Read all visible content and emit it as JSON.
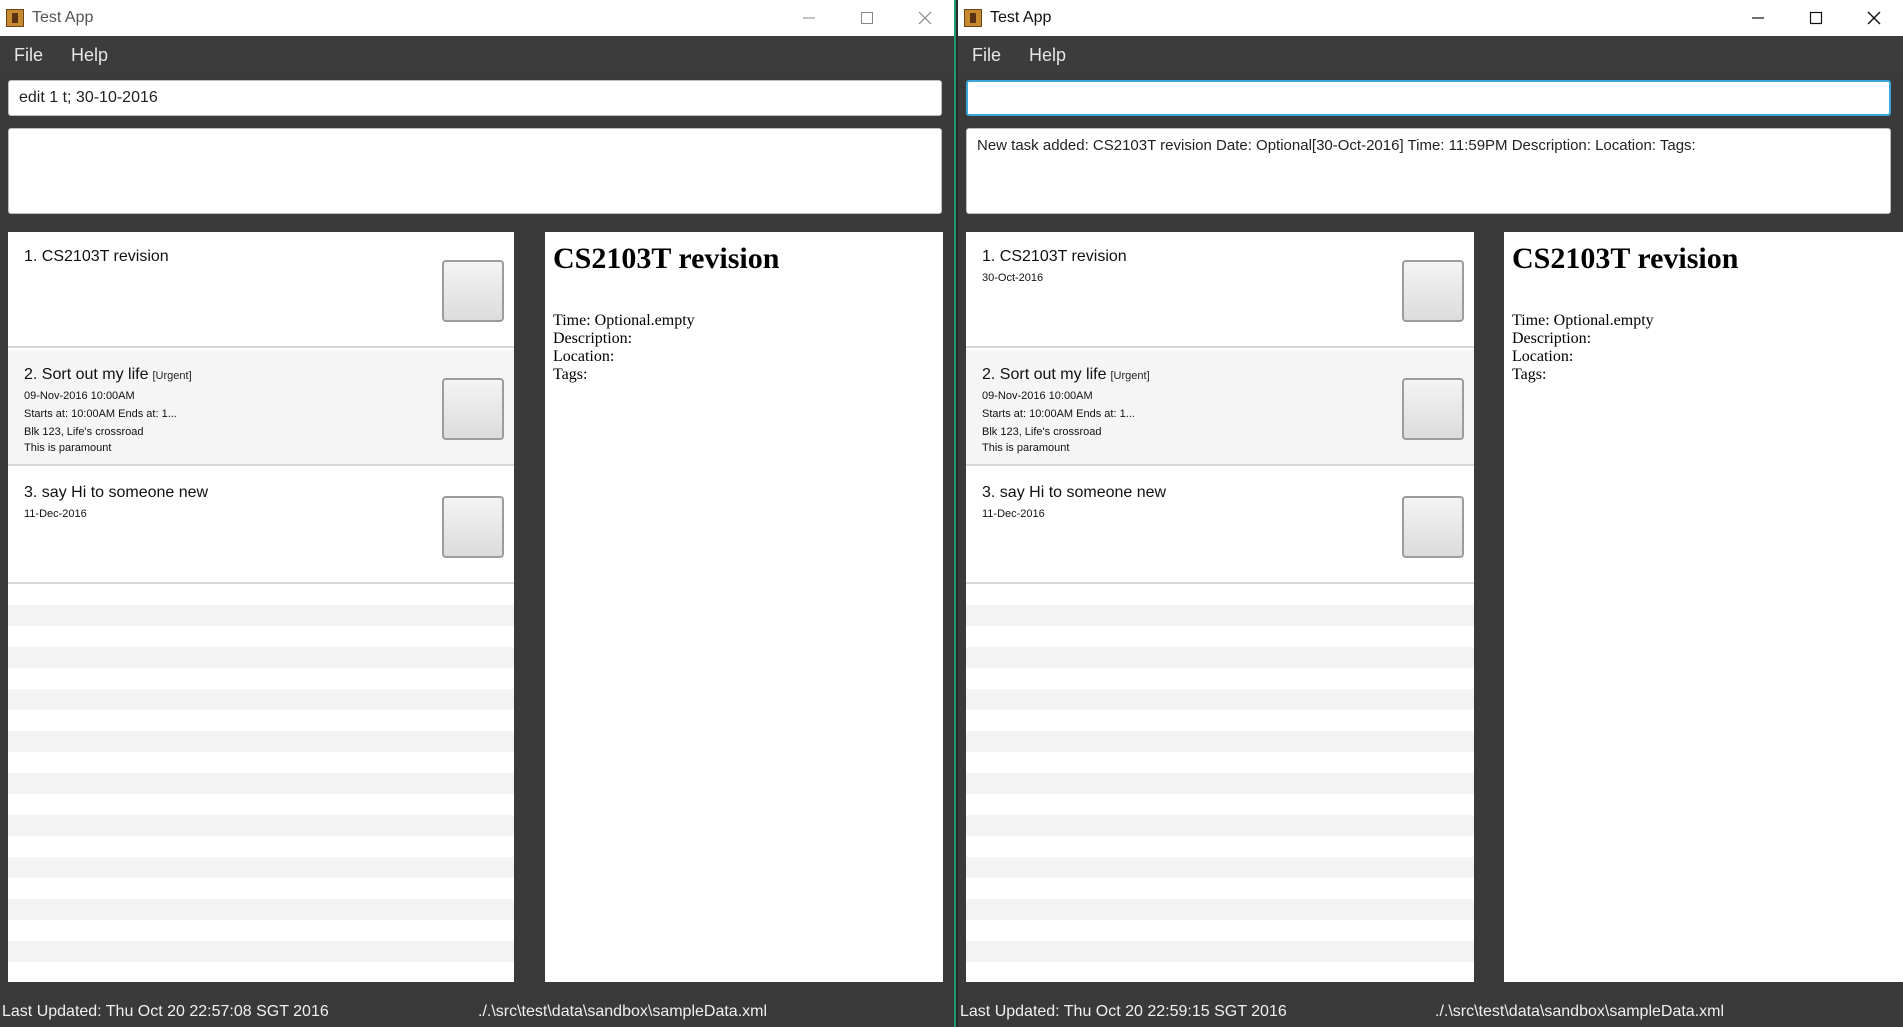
{
  "left_window": {
    "title": "Test App",
    "menu": [
      "File",
      "Help"
    ],
    "command_value": "edit 1 t; 30-10-2016",
    "result_text": "",
    "tasks": [
      {
        "title": "1. CS2103T revision",
        "tag": "",
        "lines": []
      },
      {
        "title": "2. Sort out my life",
        "tag": "[Urgent]",
        "lines": [
          "09-Nov-2016 10:00AM",
          "Starts at: 10:00AM   Ends at: 1...",
          "Blk 123, Life's crossroad",
          "This is paramount"
        ]
      },
      {
        "title": "3. say Hi to someone new",
        "tag": "",
        "lines": [
          "11-Dec-2016"
        ]
      }
    ],
    "detail": {
      "title": "CS2103T revision",
      "time": "Time: Optional.empty",
      "description": "Description:",
      "location": "Location:",
      "tags": "Tags:"
    },
    "status_left": "Last Updated: Thu Oct 20 22:57:08 SGT 2016",
    "status_right": "./.\\src\\test\\data\\sandbox\\sampleData.xml"
  },
  "right_window": {
    "title": "Test App",
    "menu": [
      "File",
      "Help"
    ],
    "command_value": "",
    "result_text": "New task added: CS2103T revision Date: Optional[30-Oct-2016] Time: 11:59PM Description:  Location:   Tags:",
    "tasks": [
      {
        "title": "1. CS2103T revision",
        "tag": "",
        "lines": [
          "30-Oct-2016"
        ]
      },
      {
        "title": "2. Sort out my life",
        "tag": "[Urgent]",
        "lines": [
          "09-Nov-2016 10:00AM",
          "Starts at: 10:00AM   Ends at: 1...",
          "Blk 123, Life's crossroad",
          "This is paramount"
        ]
      },
      {
        "title": "3. say Hi to someone new",
        "tag": "",
        "lines": [
          "11-Dec-2016"
        ]
      }
    ],
    "detail": {
      "title": "CS2103T revision",
      "time": "Time: Optional.empty",
      "description": "Description:",
      "location": "Location:",
      "tags": "Tags:"
    },
    "status_left": "Last Updated: Thu Oct 20 22:59:15 SGT 2016",
    "status_right": "./.\\src\\test\\data\\sandbox\\sampleData.xml"
  },
  "icons": {
    "app": "app-icon",
    "minimize": "minimize-icon",
    "maximize": "maximize-icon",
    "close": "close-icon"
  },
  "colors": {
    "window_bg": "#3a3a3a",
    "active_input_border": "#3aa8d8",
    "divider_accent": "#1e9a6e"
  }
}
